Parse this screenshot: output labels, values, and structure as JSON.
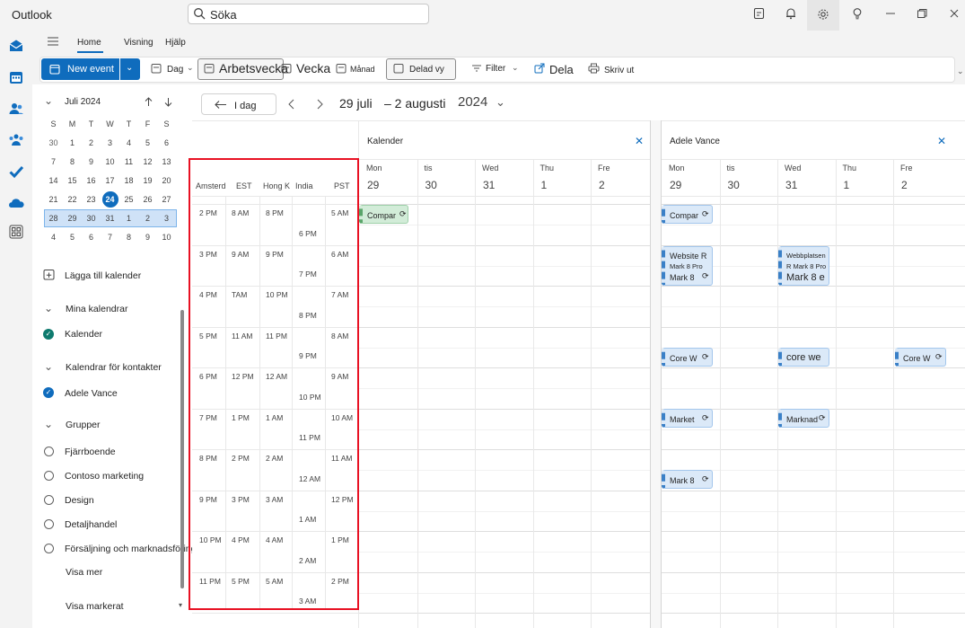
{
  "app": {
    "title": "Outlook"
  },
  "search": {
    "text": "Söka"
  },
  "tabs": [
    "Home",
    "Visning",
    "Hjälp"
  ],
  "ribbon": {
    "new_event": "New event",
    "day": "Dag",
    "work_week": "Arbetsvecka",
    "week": "Vecka",
    "month": "Månad",
    "split_view": "Delad vy",
    "filter": "Filter",
    "share": "Dela",
    "print": "Skriv ut"
  },
  "mini_calendar": {
    "month_label": "Juli 2024",
    "weekday_headers": [
      "S",
      "M",
      "T",
      "W",
      "T",
      "F",
      "S"
    ],
    "weeks": [
      [
        "30",
        "1",
        "2",
        "3",
        "4",
        "5",
        "6"
      ],
      [
        "7",
        "8",
        "9",
        "10",
        "11",
        "12",
        "13"
      ],
      [
        "14",
        "15",
        "16",
        "17",
        "18",
        "19",
        "20"
      ],
      [
        "21",
        "22",
        "23",
        "24",
        "25",
        "26",
        "27"
      ],
      [
        "28",
        "29",
        "30",
        "31",
        "1",
        "2",
        "3"
      ],
      [
        "4",
        "5",
        "6",
        "7",
        "8",
        "9",
        "10"
      ]
    ],
    "today": "24"
  },
  "sidebar": {
    "add_calendar": "Lägga till kalender",
    "my_calendars": "Mina kalendrar",
    "my_cal_item": "Kalender",
    "contacts_calendars": "Kalendrar för kontakter",
    "contact_item": "Adele Vance",
    "groups": "Grupper",
    "group_items": [
      "Fjärrboende",
      "Contoso marketing",
      "Design",
      "Detaljhandel",
      "Försäljning och marknadsföring"
    ],
    "show_more": "Visa mer",
    "show_selected": "Visa markerat"
  },
  "header": {
    "today_btn": "I dag",
    "date_range_start": "29 juli",
    "date_range_end": "– 2 augusti",
    "year": "2024"
  },
  "time_zones": {
    "headers": [
      "Amsterdam",
      "EST",
      "Hong K",
      "India",
      "PST"
    ],
    "amsterdam": [
      "2 PM",
      "3 PM",
      "4 PM",
      "5 PM",
      "6 PM",
      "7 PM",
      "8 PM",
      "9 PM",
      "10 PM",
      "11 PM"
    ],
    "est": [
      "8 AM",
      "9 AM",
      "TAM",
      "11 AM",
      "12 PM",
      "1 PM",
      "2 PM",
      "3 PM",
      "4 PM",
      "5 PM"
    ],
    "hongkong": [
      "8 PM",
      "9 PM",
      "10 PM",
      "11 PM",
      "12 AM",
      "1 AM",
      "2 AM",
      "3 AM",
      "4 AM",
      "5 AM"
    ],
    "india": [
      "6 PM",
      "7 PM",
      "8 PM",
      "9 PM",
      "10 PM",
      "11 PM",
      "12 AM",
      "1 AM",
      "2 AM",
      "3 AM"
    ],
    "pst": [
      "5 AM",
      "6 AM",
      "7 AM",
      "8 AM",
      "9 AM",
      "10 AM",
      "11 AM",
      "12 PM",
      "1 PM",
      "2 PM"
    ]
  },
  "panes": [
    {
      "title": "Kalender",
      "days": [
        {
          "name": "Mon",
          "num": "29"
        },
        {
          "name": "tis",
          "num": "30"
        },
        {
          "name": "Wed",
          "num": "31"
        },
        {
          "name": "Thu",
          "num": "1"
        },
        {
          "name": "Fre",
          "num": "2"
        }
      ]
    },
    {
      "title": "Adele Vance",
      "days": [
        {
          "name": "Mon",
          "num": "29"
        },
        {
          "name": "tis",
          "num": "30"
        },
        {
          "name": "Wed",
          "num": "31"
        },
        {
          "name": "Thu",
          "num": "1"
        },
        {
          "name": "Fre",
          "num": "2"
        }
      ]
    }
  ],
  "events": {
    "k_mon_company": "Compar",
    "a_mon_company": "Compar",
    "a_mon_website_1": "Website R",
    "a_mon_website_2": "Mark 8 Pro",
    "a_mon_website_3": "Mark 8",
    "a_wed_web_1": "Webbplatsen",
    "a_wed_web_2": "R Mark 8 Pro",
    "a_wed_web_3": "Mark 8 e",
    "a_mon_core": "Core W",
    "a_wed_core": "core we",
    "a_fri_core": "Core W",
    "a_mon_market": "Market",
    "a_wed_market": "Marknad",
    "a_mon_mark8": "Mark 8"
  },
  "colors": {
    "accent": "#0f6cbd",
    "highlight": "#e81123"
  }
}
